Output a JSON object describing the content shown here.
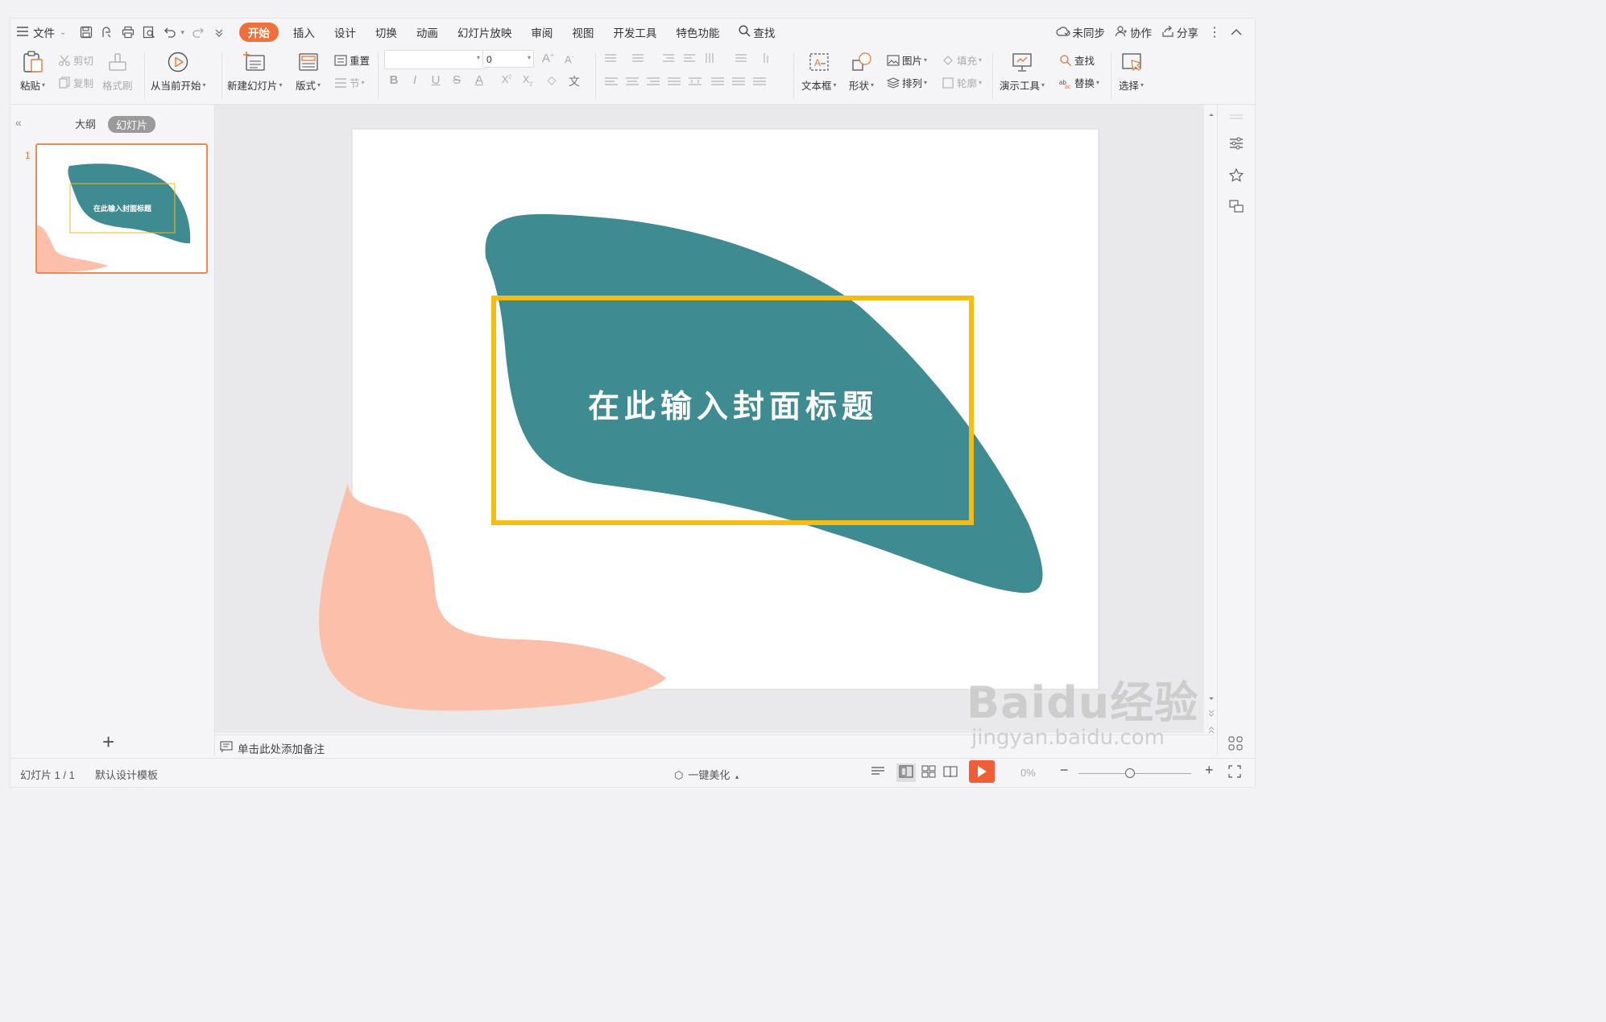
{
  "menubar": {
    "menu_label": "文件",
    "tabs": [
      "开始",
      "插入",
      "设计",
      "切换",
      "动画",
      "幻灯片放映",
      "审阅",
      "视图",
      "开发工具",
      "特色功能"
    ],
    "active_tab": "开始",
    "search_label": "查找",
    "right": {
      "sync": "未同步",
      "collab": "协作",
      "share": "分享"
    }
  },
  "ribbon": {
    "paste": "粘贴",
    "cut": "剪切",
    "copy": "复制",
    "format_painter": "格式刷",
    "play_from_current": "从当前开始",
    "new_slide": "新建幻灯片",
    "layout": "版式",
    "reset": "重置",
    "section": "节",
    "font_name": "",
    "font_size": "0",
    "text_box": "文本框",
    "shape": "形状",
    "picture": "图片",
    "fill": "填充",
    "arrange": "排列",
    "outline": "轮廓",
    "present_tools": "演示工具",
    "find": "查找",
    "replace": "替换",
    "select": "选择",
    "bold": "B",
    "italic": "I",
    "underline": "U",
    "strike": "S"
  },
  "left_panel": {
    "tab_outline": "大纲",
    "tab_slides": "幻灯片",
    "slide_number": "1"
  },
  "slide": {
    "title": "在此输入封面标题"
  },
  "notes_placeholder": "单击此处添加备注",
  "status": {
    "slide_counter": "幻灯片 1 / 1",
    "template": "默认设计模板",
    "beautify": "一键美化",
    "zoom": "0%"
  },
  "watermark": {
    "brand": "Baidu经验",
    "url": "jingyan.baidu.com"
  },
  "colors": {
    "accent": "#f0703a",
    "teal": "#3e8b91",
    "salmon": "#fbbfaa",
    "title_box": "#f6bd0f"
  }
}
